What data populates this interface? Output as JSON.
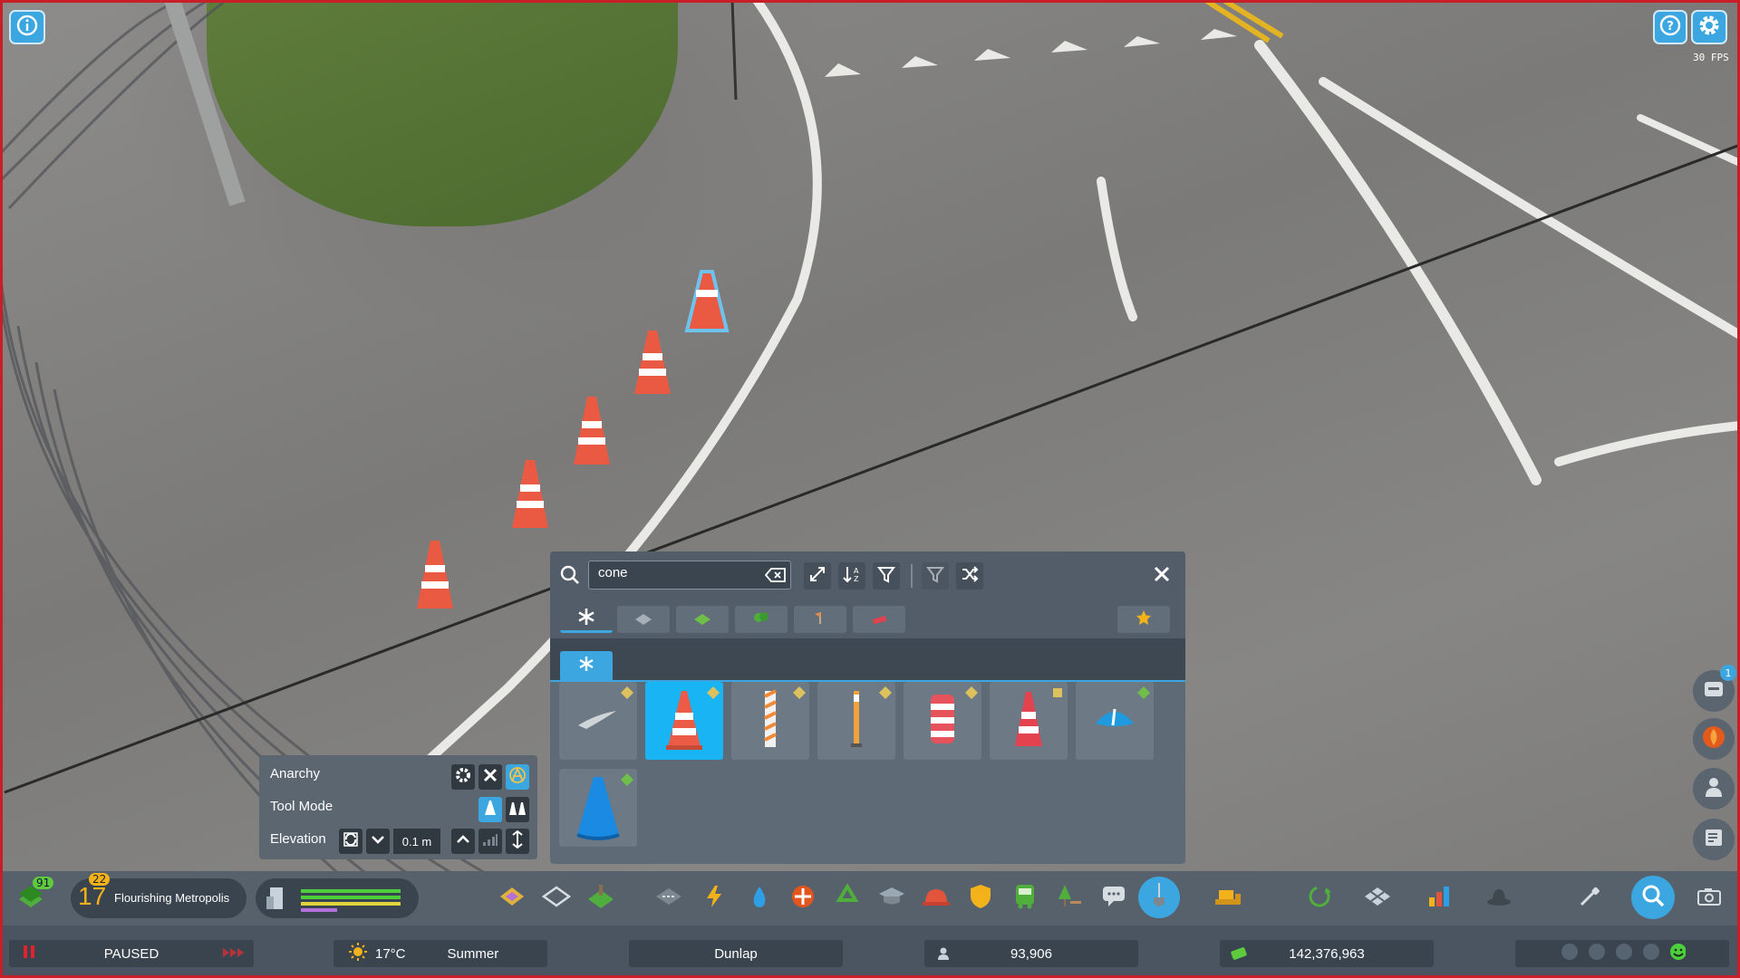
{
  "window": {
    "fps": "30 FPS"
  },
  "top_buttons": {
    "info": "info-icon",
    "help": "help-icon",
    "settings": "gear-icon"
  },
  "asset_panel": {
    "search": {
      "value": "cone",
      "placeholder": ""
    },
    "header_icons": [
      "search-icon",
      "clear-icon",
      "expand-icon",
      "sort-icon",
      "filter-icon",
      "clear-filter-icon",
      "shuffle-icon",
      "close-icon"
    ],
    "categories": [
      "all",
      "road",
      "terrain",
      "tree",
      "sign",
      "vehicle"
    ],
    "favorites_icon": "star-icon",
    "subcategory": "all",
    "items": [
      {
        "name": "road-marking-asset",
        "selected": false
      },
      {
        "name": "traffic-cone-asset",
        "selected": true
      },
      {
        "name": "striped-post-asset",
        "selected": false
      },
      {
        "name": "delineator-post-asset",
        "selected": false
      },
      {
        "name": "traffic-barrel-asset",
        "selected": false
      },
      {
        "name": "tall-cone-asset",
        "selected": false
      },
      {
        "name": "flat-blue-cone-asset",
        "selected": false
      },
      {
        "name": "blue-cone-asset",
        "selected": false
      }
    ]
  },
  "tool_options": {
    "anarchy_label": "Anarchy",
    "tool_mode_label": "Tool Mode",
    "elevation_label": "Elevation",
    "elevation_value": "0.1 m"
  },
  "toolbar": {
    "milestone_badge": "91",
    "level_number": "17",
    "level_badge": "22",
    "city_rank": "Flourishing Metropolis"
  },
  "status": {
    "play_state": "PAUSED",
    "temperature": "17°C",
    "season": "Summer",
    "city_name": "Dunlap",
    "population": "93,906",
    "money": "142,376,963"
  },
  "right_panel": {
    "notification_count": "1"
  },
  "colors": {
    "accent": "#3ba6e0",
    "selected": "#18b4f3",
    "paused": "#e0242e",
    "panel": "#5e6a76"
  }
}
